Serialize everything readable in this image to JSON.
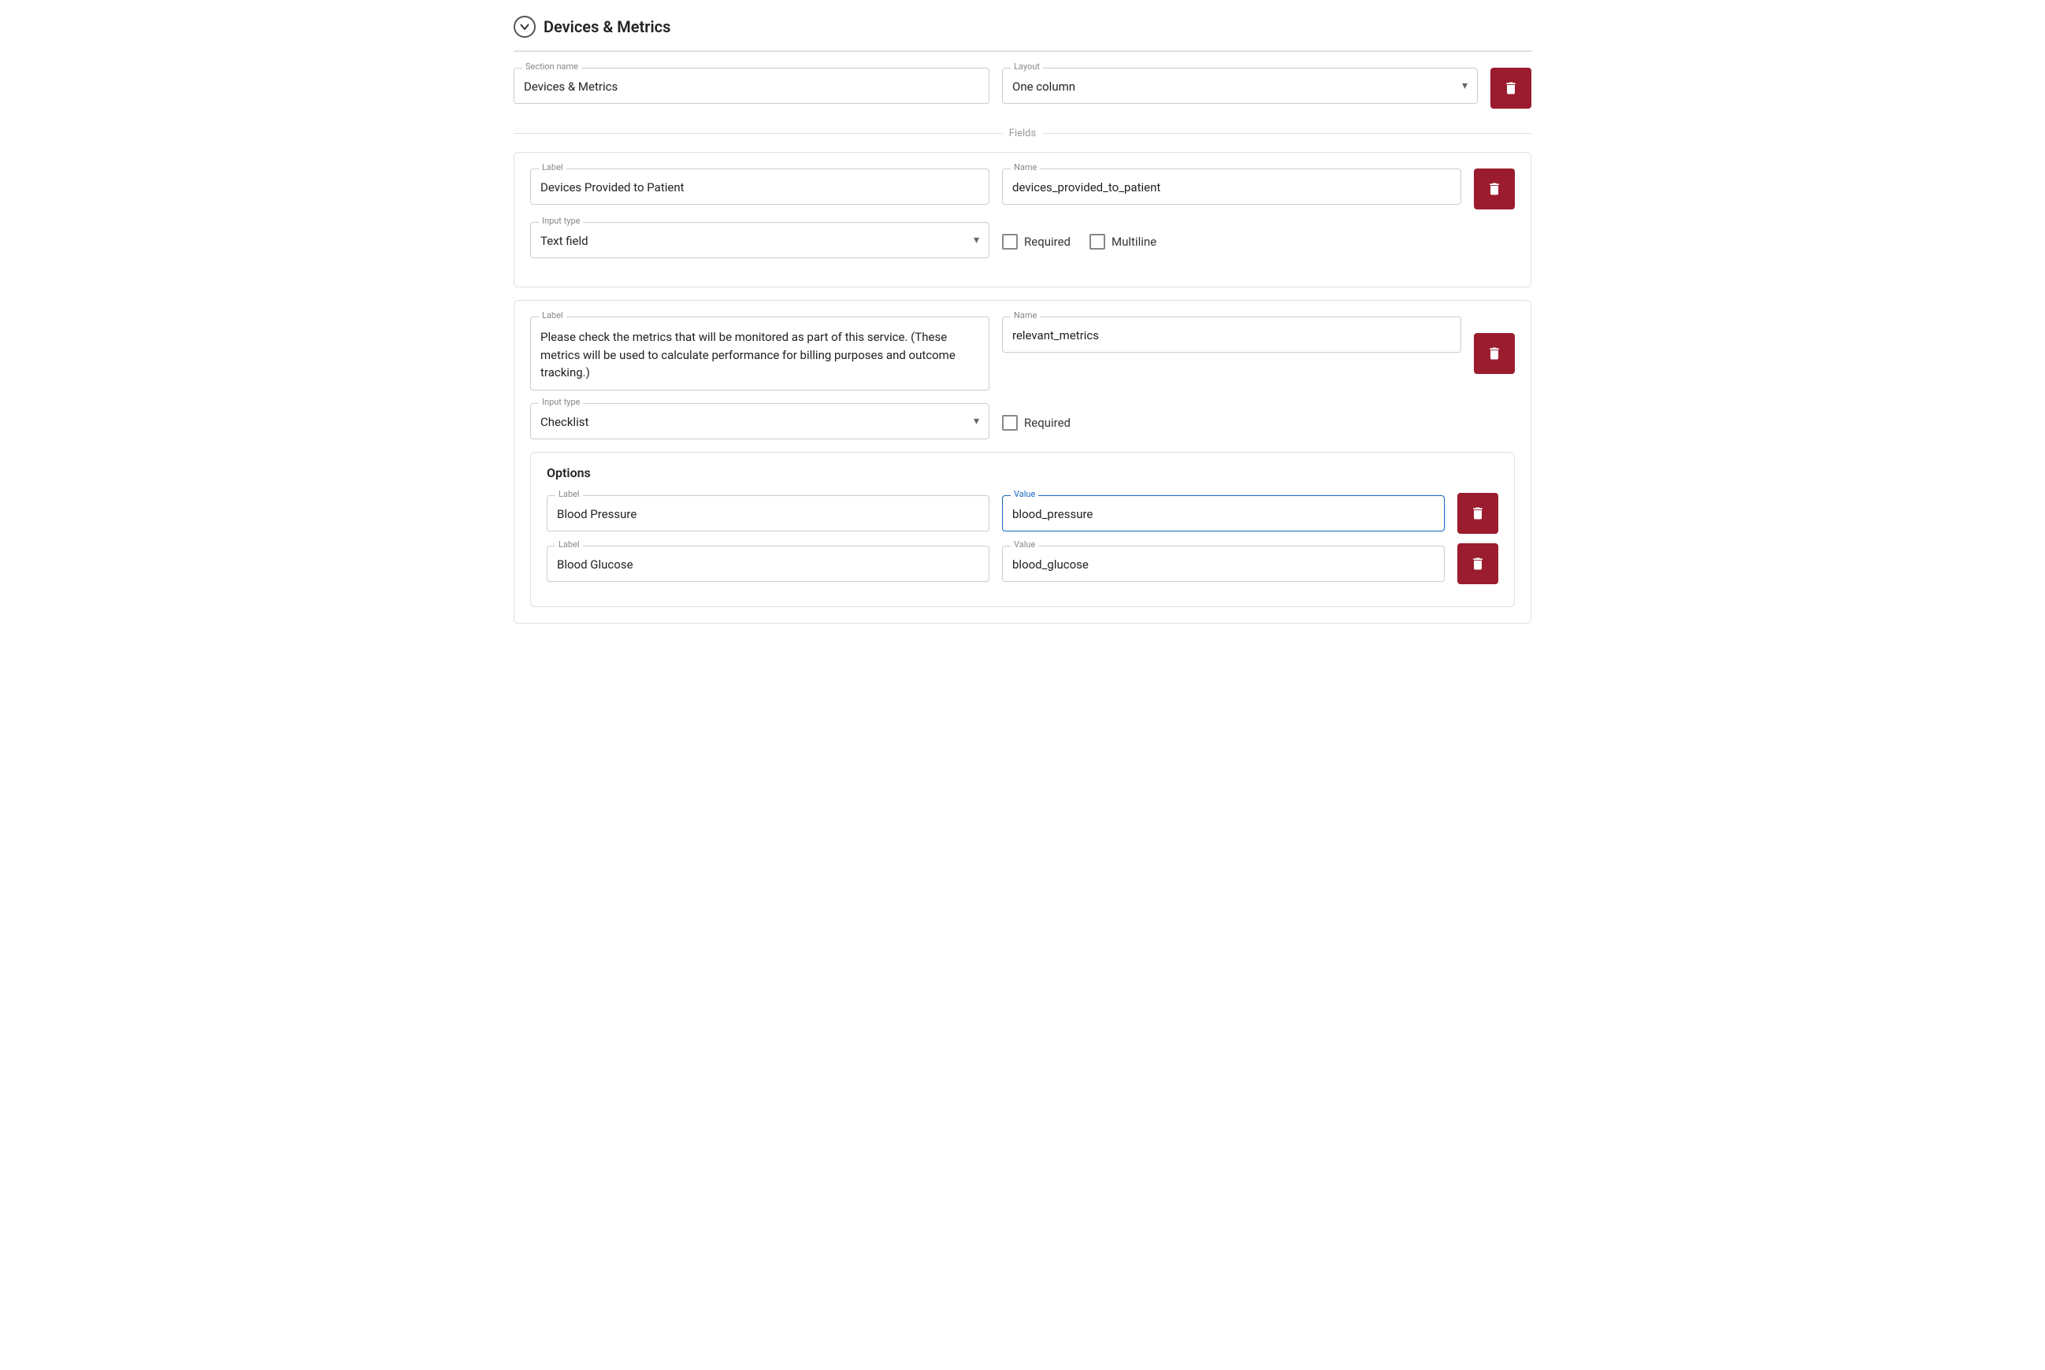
{
  "page": {
    "title": "Devices Metrics"
  },
  "section": {
    "header_title": "Devices & Metrics",
    "section_name_label": "Section name",
    "section_name_value": "Devices & Metrics",
    "layout_label": "Layout",
    "layout_value": "One column",
    "fields_label": "Fields"
  },
  "field1": {
    "label_label": "Label",
    "label_value": "Devices Provided to Patient",
    "name_label": "Name",
    "name_value": "devices_provided_to_patient",
    "input_type_label": "Input type",
    "input_type_value": "Text field",
    "required_label": "Required",
    "multiline_label": "Multiline"
  },
  "field2": {
    "label_label": "Label",
    "label_value": "Please check the metrics that will be monitored as part of this service. (These metrics will be used to calculate performance for billing purposes and outcome tracking.)",
    "name_label": "Name",
    "name_value": "relevant_metrics",
    "input_type_label": "Input type",
    "input_type_value": "Checklist",
    "required_label": "Required",
    "options_title": "Options",
    "option1": {
      "label_label": "Label",
      "label_value": "Blood Pressure",
      "value_label": "Value",
      "value_value": "blood_pressure"
    },
    "option2": {
      "label_label": "Label",
      "label_value": "Blood Glucose",
      "value_label": "Value",
      "value_value": "blood_glucose"
    }
  },
  "icons": {
    "chevron_down": "▾",
    "trash": "🗑"
  },
  "colors": {
    "delete_btn": "#9b1c2e",
    "active_border": "#1565c0"
  }
}
